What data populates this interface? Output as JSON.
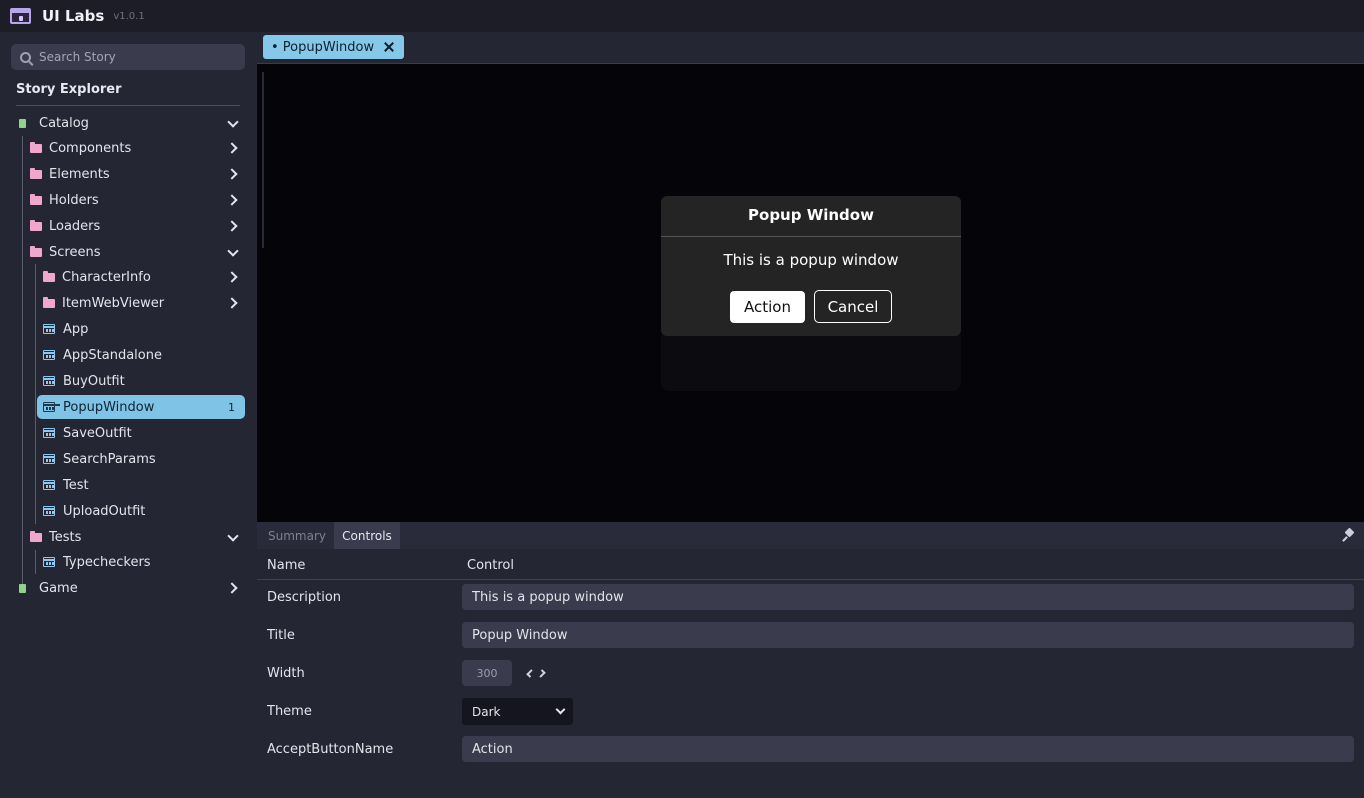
{
  "app": {
    "title": "UI Labs",
    "version": "v1.0.1"
  },
  "sidebar": {
    "search_placeholder": "Search Story",
    "explorer_title": "Story Explorer",
    "tree": {
      "catalog": "Catalog",
      "components": "Components",
      "elements": "Elements",
      "holders": "Holders",
      "loaders": "Loaders",
      "screens": "Screens",
      "character_info": "CharacterInfo",
      "item_web_viewer": "ItemWebViewer",
      "app": "App",
      "app_standalone": "AppStandalone",
      "buy_outfit": "BuyOutfit",
      "popup_window": "PopupWindow",
      "popup_window_badge": "1",
      "save_outfit": "SaveOutfit",
      "search_params": "SearchParams",
      "test": "Test",
      "upload_outfit": "UploadOutfit",
      "tests": "Tests",
      "typecheckers": "Typecheckers",
      "game": "Game"
    }
  },
  "tabbar": {
    "active_tab": "• PopupWindow"
  },
  "popup": {
    "title": "Popup Window",
    "description": "This is a popup window",
    "action_label": "Action",
    "cancel_label": "Cancel"
  },
  "panel": {
    "tabs": {
      "summary": "Summary",
      "controls": "Controls"
    },
    "headers": {
      "name": "Name",
      "control": "Control"
    },
    "controls": {
      "description": {
        "label": "Description",
        "value": "This is a popup window"
      },
      "title": {
        "label": "Title",
        "value": "Popup Window"
      },
      "width": {
        "label": "Width",
        "value": "300"
      },
      "theme": {
        "label": "Theme",
        "value": "Dark"
      },
      "accept_button_name": {
        "label": "AcceptButtonName",
        "value": "Action"
      }
    }
  },
  "colors": {
    "accent": "#86c8ea",
    "folder": "#f0a6cf",
    "root": "#8fd28a",
    "story": "#8fc7f0",
    "logo": "#b9a6e8"
  }
}
